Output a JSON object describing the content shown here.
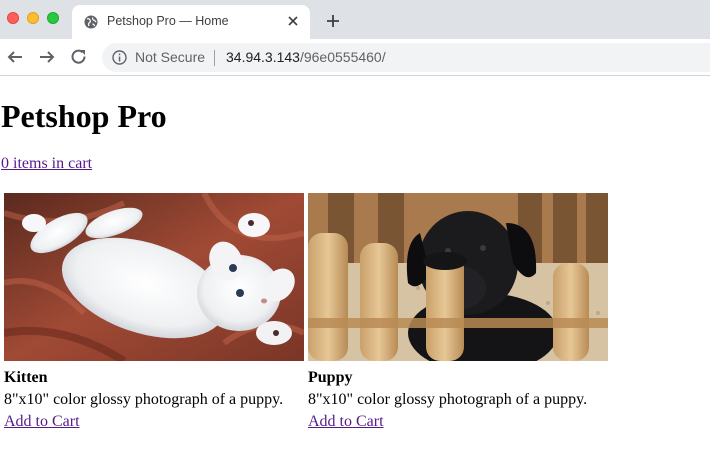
{
  "browser": {
    "tab_title": "Petshop Pro — Home",
    "security_label": "Not Secure",
    "url_host": "34.94.3.143",
    "url_path": "/96e0555460/"
  },
  "page": {
    "heading": "Petshop Pro",
    "cart_link": "0 items in cart"
  },
  "products": [
    {
      "name": "Kitten",
      "description": "8\"x10\" color glossy photograph of a puppy.",
      "add_to_cart": "Add to Cart"
    },
    {
      "name": "Puppy",
      "description": "8\"x10\" color glossy photograph of a puppy.",
      "add_to_cart": "Add to Cart"
    }
  ],
  "icons": {
    "tab_favicon": "globe-icon",
    "tab_close": "close-icon",
    "new_tab": "plus-icon",
    "back": "arrow-left-icon",
    "forward": "arrow-right-icon",
    "reload": "reload-icon",
    "security": "info-icon"
  }
}
